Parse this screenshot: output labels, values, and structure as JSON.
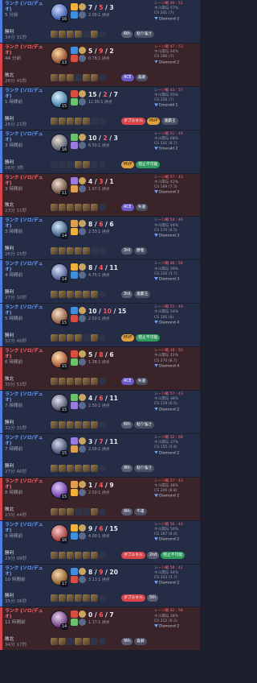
{
  "colors": {
    "win": "#4f7ee0",
    "loss": "#d9454a",
    "mvp": "#e1a13a",
    "ace": "#6a58c8"
  },
  "matches": [
    {
      "result": "win",
      "queue": "ランク (ソロ/デュオ)",
      "ago": "5 分前",
      "result_text": "勝利",
      "duration": "34分 31秒",
      "level": "16",
      "k": "7",
      "d": "5",
      "a": "3",
      "kda": "2.00:1 評点",
      "items": [
        "f",
        "f",
        "f",
        "f",
        "e",
        "f",
        "w"
      ],
      "badges": [
        {
          "t": "6th",
          "c": "rank"
        },
        {
          "t": "粘り強さ",
          "c": "gray"
        }
      ],
      "pk": "レーン戦 49 : 51",
      "kp": "キル関与 57%",
      "cs": "CS 241 (7)",
      "tier": "Diamond 2"
    },
    {
      "result": "loss",
      "queue": "ランク (ソロ/デュオ)",
      "ago": "44 分前",
      "result_text": "敗北",
      "duration": "26分 45秒",
      "level": "13",
      "k": "5",
      "d": "9",
      "a": "2",
      "kda": "0.78:1 評点",
      "items": [
        "f",
        "f",
        "f",
        "e",
        "f",
        "f",
        "w"
      ],
      "badges": [
        {
          "t": "ACE",
          "c": "ace"
        },
        {
          "t": "喜劇",
          "c": "gray"
        }
      ],
      "pk": "レーン戦 47 : 53",
      "kp": "キル関与 44%",
      "cs": "CS 186 (7)",
      "tier": "Diamond 2"
    },
    {
      "result": "win",
      "queue": "ランク (ソロ/デュオ)",
      "ago": "1 時間前",
      "result_text": "勝利",
      "duration": "26分 21秒",
      "level": "15",
      "k": "15",
      "d": "2",
      "a": "7",
      "kda": "11.00:1 評点",
      "items": [
        "f",
        "f",
        "f",
        "f",
        "f",
        "e",
        "w"
      ],
      "badges": [
        {
          "t": "ダブルキル",
          "c": "dbl"
        },
        {
          "t": "MVP",
          "c": "mvp"
        },
        {
          "t": "連覇王",
          "c": "gray"
        }
      ],
      "pk": "レーン戦 43 : 57",
      "kp": "キル関与 55%",
      "cs": "CS 256 (7)",
      "tier": "Emerald 1"
    },
    {
      "result": "win",
      "queue": "ランク (ソロ/デュオ)",
      "ago": "3 時間前",
      "result_text": "勝利",
      "duration": "26分 3秒",
      "level": "16",
      "k": "10",
      "d": "2",
      "a": "3",
      "kda": "6.50:1 評点",
      "items": [
        "e",
        "e",
        "e",
        "f",
        "f",
        "e",
        "w"
      ],
      "badges": [
        {
          "t": "MVP",
          "c": "mvp"
        },
        {
          "t": "阻止不可能",
          "c": "grn"
        }
      ],
      "pk": "レーン戦 51 : 49",
      "kp": "キル関与 68%",
      "cs": "CS 231 (8.7)",
      "tier": "Emerald 2"
    },
    {
      "result": "loss",
      "queue": "ランク (ソロ/デュオ)",
      "ago": "3 時間前",
      "result_text": "敗北",
      "duration": "23分 11秒",
      "level": "11",
      "k": "4",
      "d": "3",
      "a": "1",
      "kda": "1.67:1 評点",
      "items": [
        "f",
        "f",
        "f",
        "f",
        "f",
        "f",
        "w"
      ],
      "badges": [
        {
          "t": "ACE",
          "c": "ace"
        },
        {
          "t": "失速",
          "c": "gray"
        }
      ],
      "pk": "レーン戦 57 : 43",
      "kp": "キル関与 42%",
      "cs": "CS 169 (7.3)",
      "tier": "Diamond 3"
    },
    {
      "result": "win",
      "queue": "ランク (ソロ/デュオ)",
      "ago": "3 時間前",
      "result_text": "勝利",
      "duration": "26分 15秒",
      "level": "14",
      "k": "8",
      "d": "6",
      "a": "6",
      "kda": "2.33:1 評点",
      "items": [
        "f",
        "f",
        "f",
        "f",
        "f",
        "e",
        "w"
      ],
      "badges": [
        {
          "t": "3rd",
          "c": "rank"
        },
        {
          "t": "勝者",
          "c": "gray"
        }
      ],
      "pk": "レーン戦 54 : 46",
      "kp": "キル関与 44%",
      "cs": "CS 170 (6.5)",
      "tier": "Diamond 3"
    },
    {
      "result": "win",
      "queue": "ランク (ソロ/デュオ)",
      "ago": "4 時間前",
      "result_text": "勝利",
      "duration": "27分 10秒",
      "level": "14",
      "k": "8",
      "d": "4",
      "a": "11",
      "kda": "4.75:1 評点",
      "items": [
        "f",
        "f",
        "f",
        "f",
        "f",
        "f",
        "w"
      ],
      "badges": [
        {
          "t": "3rd",
          "c": "rank"
        },
        {
          "t": "連覇王",
          "c": "gray"
        }
      ],
      "pk": "レーン戦 46 : 54",
      "kp": "キル関与 59%",
      "cs": "CS 156 (5.7)",
      "tier": "Diamond 3"
    },
    {
      "result": "win",
      "queue": "ランク (ソロ/デュオ)",
      "ago": "5 時間前",
      "result_text": "勝利",
      "duration": "32分 46秒",
      "level": "15",
      "k": "10",
      "d": "10",
      "a": "15",
      "kda": "2.50:1 評点",
      "items": [
        "f",
        "f",
        "f",
        "f",
        "e",
        "f",
        "w"
      ],
      "badges": [
        {
          "t": "MVP",
          "c": "mvp"
        },
        {
          "t": "阻止不可能",
          "c": "grn"
        }
      ],
      "pk": "レーン戦 51 : 49",
      "kp": "キル関与 54%",
      "cs": "CS 195 (6)",
      "tier": "Diamond 4"
    },
    {
      "result": "loss",
      "queue": "ランク (ソロ/デュオ)",
      "ago": "6 時間前",
      "result_text": "敗北",
      "duration": "30分 53秒",
      "level": "15",
      "k": "5",
      "d": "8",
      "a": "6",
      "kda": "1.38:1 評点",
      "items": [
        "f",
        "f",
        "f",
        "f",
        "f",
        "f",
        "w"
      ],
      "badges": [
        {
          "t": "ACE",
          "c": "ace"
        },
        {
          "t": "失速",
          "c": "gray"
        }
      ],
      "pk": "レーン戦 48 : 50",
      "kp": "キル関与 42%",
      "cs": "CS 270 (8.7)",
      "tier": "Diamond 4"
    },
    {
      "result": "win",
      "queue": "ランク (ソロ/デュオ)",
      "ago": "7 時間前",
      "result_text": "勝利",
      "duration": "32分 31秒",
      "level": "15",
      "k": "4",
      "d": "6",
      "a": "11",
      "kda": "2.50:1 評点",
      "items": [
        "f",
        "f",
        "f",
        "f",
        "f",
        "f",
        "w"
      ],
      "badges": [
        {
          "t": "6th",
          "c": "rank"
        },
        {
          "t": "粘り強さ",
          "c": "gray"
        }
      ],
      "pk": "レーン戦 57 : 43",
      "kp": "キル関与 38%",
      "cs": "CS 219 (6.5)",
      "tier": "Diamond 2"
    },
    {
      "result": "win",
      "queue": "ランク (ソロ/デュオ)",
      "ago": "7 時間前",
      "result_text": "勝利",
      "duration": "27分 46秒",
      "level": "15",
      "k": "3",
      "d": "7",
      "a": "11",
      "kda": "2.00:1 評点",
      "items": [
        "f",
        "f",
        "f",
        "f",
        "f",
        "f",
        "w"
      ],
      "badges": [
        {
          "t": "9th",
          "c": "rank"
        },
        {
          "t": "粘り強さ",
          "c": "gray"
        }
      ],
      "pk": "レーン戦 32 : 68",
      "kp": "キル関与 37%",
      "cs": "CS 155 (5.6)",
      "tier": "Diamond 2"
    },
    {
      "result": "loss",
      "queue": "ランク (ソロ/デュオ)",
      "ago": "8 時間前",
      "result_text": "敗北",
      "duration": "23分 44秒",
      "level": "15",
      "k": "1",
      "d": "4",
      "a": "9",
      "kda": "2.50:1 評点",
      "items": [
        "f",
        "f",
        "f",
        "e",
        "e",
        "f",
        "w"
      ],
      "badges": [
        {
          "t": "9th",
          "c": "rank"
        },
        {
          "t": "不運",
          "c": "gray"
        }
      ],
      "pk": "レーン戦 57 : 43",
      "kp": "キル関与 48%",
      "cs": "CS 206 (8.8)",
      "tier": "Diamond 2"
    },
    {
      "result": "win",
      "queue": "ランク (ソロ/デュオ)",
      "ago": "9 時間前",
      "result_text": "勝利",
      "duration": "29分 09秒",
      "level": "16",
      "k": "9",
      "d": "6",
      "a": "15",
      "kda": "4.00:1 評点",
      "items": [
        "f",
        "f",
        "f",
        "f",
        "f",
        "f",
        "w"
      ],
      "badges": [
        {
          "t": "ダブルキル",
          "c": "dbl"
        },
        {
          "t": "2nd",
          "c": "rank"
        },
        {
          "t": "阻止不可能",
          "c": "grn"
        }
      ],
      "pk": "レーン戦 56 : 44",
      "kp": "キル関与 50%",
      "cs": "CS 187 (6.4)",
      "tier": "Diamond 2"
    },
    {
      "result": "win",
      "queue": "ランク (ソロ/デュオ)",
      "ago": "10 時間前",
      "result_text": "勝利",
      "duration": "35分 36秒",
      "level": "17",
      "k": "8",
      "d": "9",
      "a": "20",
      "kda": "3.11:1 評点",
      "items": [
        "f",
        "f",
        "f",
        "f",
        "f",
        "f",
        "w"
      ],
      "badges": [
        {
          "t": "ダブルキル",
          "c": "dbl"
        },
        {
          "t": "5th",
          "c": "rank"
        }
      ],
      "pk": "レーン戦 58 : 42",
      "kp": "キル関与 44%",
      "cs": "CS 203 (5.7)",
      "tier": "Diamond 2"
    },
    {
      "result": "loss",
      "queue": "ランク (ソロ/デュオ)",
      "ago": "11 時間前",
      "result_text": "敗北",
      "duration": "34分 17秒",
      "level": "14",
      "k": "0",
      "d": "6",
      "a": "7",
      "kda": "1.17:1 評点",
      "items": [
        "f",
        "f",
        "e",
        "f",
        "f",
        "e",
        "w"
      ],
      "badges": [
        {
          "t": "9th",
          "c": "rank"
        },
        {
          "t": "喜劇",
          "c": "gray"
        }
      ],
      "pk": "レーン戦 42 : 58",
      "kp": "キル関与 28%",
      "cs": "CS 212 (6.2)",
      "tier": "Diamond 2"
    }
  ]
}
